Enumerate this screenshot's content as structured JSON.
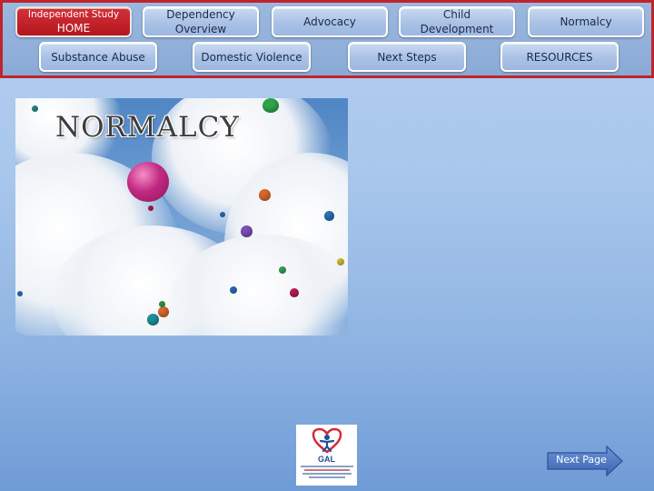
{
  "nav": {
    "home": {
      "title": "Independent Study",
      "subtitle": "HOME"
    },
    "dependency_overview": {
      "line1": "Dependency",
      "line2": "Overview"
    },
    "advocacy": "Advocacy",
    "child_development": {
      "line1": "Child",
      "line2": "Development"
    },
    "normalcy": "Normalcy",
    "substance_abuse": "Substance Abuse",
    "domestic_violence": "Domestic Violence",
    "next_steps": "Next Steps",
    "resources": "RESOURCES"
  },
  "hero": {
    "title": "NORMALCY"
  },
  "logo": {
    "text": "GAL"
  },
  "footer": {
    "next_page": "Next Page"
  },
  "colors": {
    "nav_border": "#c0242b",
    "home_button": "#c41e26",
    "nav_button": "#b3c9ea",
    "background_top": "#b3cff0",
    "background_bottom": "#6f9bd6",
    "next_arrow": "#4a76c2"
  },
  "icons": {
    "next_page": "right-arrow-icon",
    "logo": "gal-heart-logo"
  }
}
